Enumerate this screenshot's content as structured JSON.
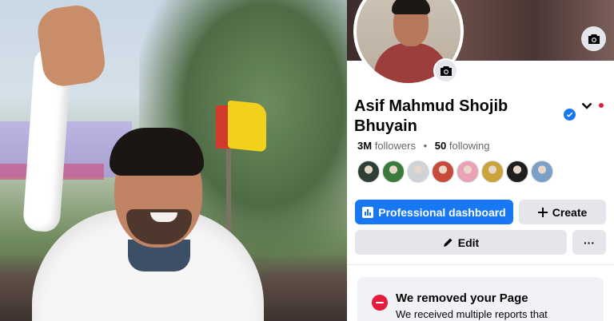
{
  "profile": {
    "name": "Asif Mahmud Shojib Bhuyain",
    "followers_count": "3M",
    "followers_label": "followers",
    "separator": "•",
    "following_count": "50",
    "following_label": "following"
  },
  "friends": [
    {
      "color": "#2f3f35"
    },
    {
      "color": "#3a7a3a"
    },
    {
      "color": "#cfd2d6"
    },
    {
      "color": "#c84a3a"
    },
    {
      "color": "#e9a2b6"
    },
    {
      "color": "#c9a23a"
    },
    {
      "color": "#1e1e1e"
    },
    {
      "color": "#7aa0c8"
    }
  ],
  "actions": {
    "professional_dashboard": "Professional dashboard",
    "create": "Create",
    "edit": "Edit",
    "more": "···"
  },
  "notice": {
    "title": "We removed your Page",
    "body": "We received multiple reports that"
  },
  "colors": {
    "accent": "#1877f2",
    "alert": "#e41e3f",
    "button_gray": "#e4e6eb"
  }
}
